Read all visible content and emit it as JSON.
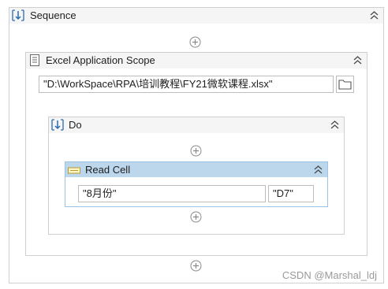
{
  "sequence": {
    "title": "Sequence"
  },
  "excel_scope": {
    "title": "Excel Application Scope",
    "workbook_path": "\"D:\\WorkSpace\\RPA\\培训教程\\FY21微软课程.xlsx\""
  },
  "do_block": {
    "title": "Do"
  },
  "read_cell": {
    "title": "Read Cell",
    "sheet_name": "\"8月份\"",
    "cell": "\"D7\""
  },
  "watermark": "CSDN @Marshal_ldj",
  "colors": {
    "border": "#cfcfcf",
    "header_bg": "#f5f5f5",
    "selected_header_bg": "#bcd6ec",
    "selected_border": "#9cc2e5",
    "icon_blue": "#2b6cb0"
  }
}
